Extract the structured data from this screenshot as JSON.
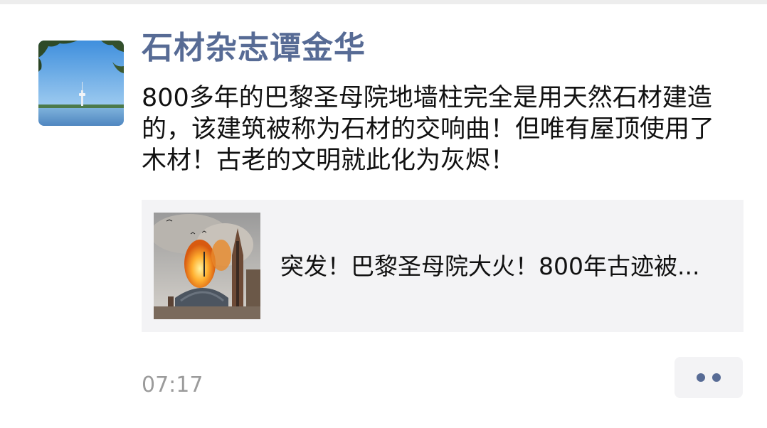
{
  "post": {
    "author_name": "石材杂志谭金华",
    "text_lines": [
      "800多年的巴黎圣母院地墙柱完全是用天然石材建造",
      "的，该建筑被称为石材的交响曲！但唯有屋顶使用了",
      "木材！古老的文明就此化为灰烬！"
    ],
    "link": {
      "title": "突发！巴黎圣母院大火！800年古迹被..."
    },
    "time": "07:17"
  },
  "icons": {
    "avatar": "avatar-photo-tower-lake",
    "thumbnail": "notre-dame-fire-photo",
    "more": "more-dots-icon"
  },
  "colors": {
    "name": "#576b95",
    "text": "#111111",
    "card_bg": "#f3f3f5",
    "time": "#9b9b9b"
  }
}
